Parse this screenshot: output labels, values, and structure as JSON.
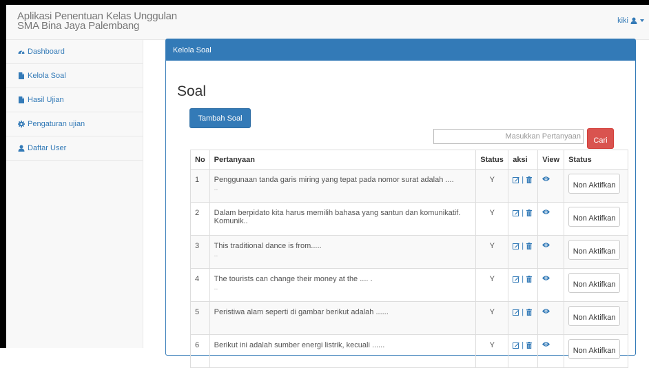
{
  "app": {
    "title_line1": "Aplikasi Penentuan Kelas Unggulan",
    "title_line2": "SMA Bina Jaya Palembang"
  },
  "user_menu": {
    "username": "kiki",
    "icon": "user-icon"
  },
  "sidebar": {
    "items": [
      {
        "label": "Dashboard",
        "icon": "dashboard-icon"
      },
      {
        "label": "Kelola Soal",
        "icon": "file-icon"
      },
      {
        "label": "Hasil Ujian",
        "icon": "file-icon"
      },
      {
        "label": "Pengaturan ujian",
        "icon": "gear-icon"
      },
      {
        "label": "Daftar User",
        "icon": "user-icon"
      }
    ]
  },
  "panel": {
    "heading": "Kelola Soal"
  },
  "page": {
    "title": "Soal",
    "add_button": "Tambah Soal",
    "search_placeholder": "Masukkan Pertanyaan",
    "search_button": "Cari"
  },
  "table": {
    "headers": [
      "No",
      "Pertanyaan",
      "Status",
      "aksi",
      "View",
      "Status"
    ],
    "rows": [
      {
        "no": "1",
        "question": "Penggunaan tanda garis miring yang tepat pada nomor surat adalah ....",
        "dots": "..",
        "status": "Y",
        "action": "Non Aktifkan"
      },
      {
        "no": "2",
        "question": "Dalam berpidato kita harus memilih bahasa yang santun dan komunikatif. Komunik..",
        "dots": "",
        "status": "Y",
        "action": "Non Aktifkan"
      },
      {
        "no": "3",
        "question": "This traditional dance is from.....",
        "dots": "..",
        "status": "Y",
        "action": "Non Aktifkan"
      },
      {
        "no": "4",
        "question": "The tourists can change their money at the .... .",
        "dots": "..",
        "status": "Y",
        "action": "Non Aktifkan"
      },
      {
        "no": "5",
        "question": "Peristiwa alam seperti di gambar berikut adalah ......",
        "dots": "",
        "status": "Y",
        "action": "Non Aktifkan"
      },
      {
        "no": "6",
        "question": "Berikut ini adalah sumber energi listrik, kecuali ......",
        "dots": "",
        "status": "Y",
        "action": "Non Aktifkan"
      }
    ]
  },
  "colors": {
    "primary": "#337ab7",
    "danger": "#d9534f",
    "sidebar_bg": "#f8f8f8"
  }
}
